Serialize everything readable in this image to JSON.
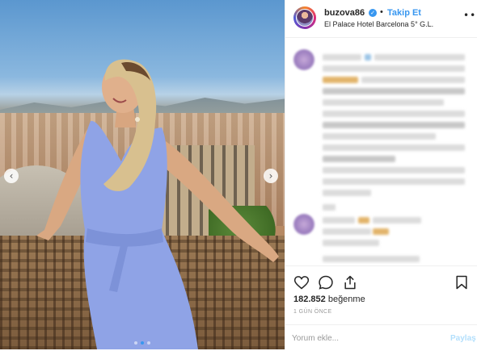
{
  "header": {
    "username": "buzova86",
    "verified_symbol": "✓",
    "separator": "•",
    "follow_label": "Takip Et",
    "location": "El Palace Hotel Barcelona 5° G.L."
  },
  "photo": {
    "prev_symbol": "‹",
    "next_symbol": "›",
    "carousel_dots": 2,
    "active_dot": 1
  },
  "actions": {
    "like_icon": "heart-icon",
    "comment_icon": "comment-icon",
    "share_icon": "share-icon",
    "save_icon": "bookmark-icon",
    "likes_count": "182.852",
    "likes_suffix": "beğenme",
    "timestamp": "1 GÜN ÖNCE"
  },
  "comment_box": {
    "placeholder": "Yorum ekle...",
    "post_label": "Paylaş"
  },
  "colors": {
    "accent": "#3897f0",
    "post_disabled": "#b2dffc",
    "text": "#262626",
    "muted": "#999999"
  }
}
